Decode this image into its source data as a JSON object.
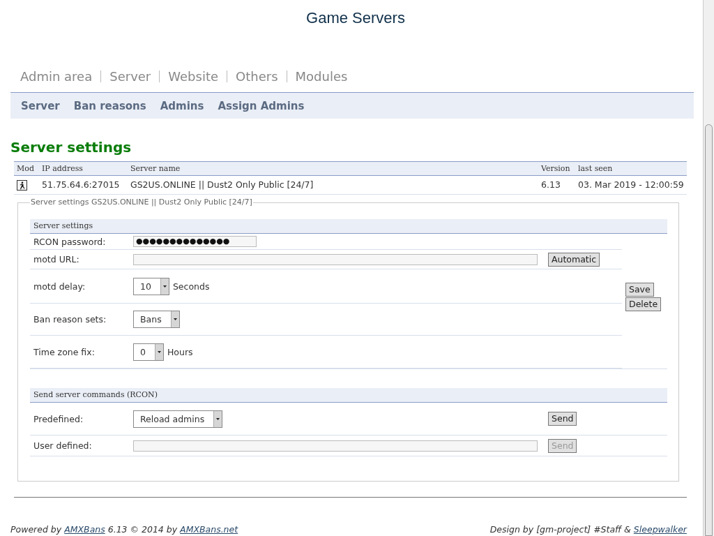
{
  "header": {
    "subtitle": "Game Servers"
  },
  "main_nav": [
    "Admin area",
    "Server",
    "Website",
    "Others",
    "Modules"
  ],
  "sub_nav": [
    "Server",
    "Ban reasons",
    "Admins",
    "Assign Admins"
  ],
  "page_title": "Server settings",
  "server_table": {
    "columns": [
      "Mod",
      "IP address",
      "Server name",
      "Version",
      "last seen"
    ],
    "rows": [
      {
        "ip_address": "51.75.64.6:27015",
        "server_name": "GS2US.ONLINE || Dust2 Only Public [24/7]",
        "version": "6.13",
        "last_seen": "03. Mar 2019 - 12:00:59"
      }
    ]
  },
  "server_form": {
    "legend": "Server settings GS2US.ONLINE || Dust2 Only Public [24/7]",
    "settings": {
      "title": "Server settings",
      "rows": [
        {
          "kind": "password",
          "label": "RCON password:",
          "value": "●●●●●●●●●●●●●●"
        },
        {
          "kind": "text",
          "label": "motd URL:",
          "button": {
            "label": "Automatic",
            "disabled": false
          }
        },
        {
          "kind": "select",
          "label": "motd delay:",
          "value": "10",
          "unit": "Seconds"
        },
        {
          "kind": "select",
          "label": "Ban reason sets:",
          "value": "Bans"
        },
        {
          "kind": "select",
          "label": "Time zone fix:",
          "value": "0",
          "unit": "Hours"
        }
      ],
      "side_buttons": [
        {
          "label": "Save",
          "disabled": false
        },
        {
          "label": "Delete",
          "disabled": false
        }
      ]
    },
    "rcon": {
      "title": "Send server commands (RCON)",
      "rows": [
        {
          "kind": "select",
          "label": "Predefined:",
          "value": "Reload admins",
          "button": {
            "label": "Send",
            "disabled": false
          }
        },
        {
          "kind": "text",
          "label": "User defined:",
          "button": {
            "label": "Send",
            "disabled": true
          }
        }
      ]
    }
  },
  "footer": {
    "left": [
      {
        "kind": "text",
        "text": "Powered by "
      },
      {
        "kind": "link",
        "text": "AMXBans"
      },
      {
        "kind": "text",
        "text": " 6.13 © 2014 by "
      },
      {
        "kind": "link",
        "text": "AMXBans.net"
      }
    ],
    "right": [
      {
        "kind": "text",
        "text": "Design by [gm-project] #Staff & "
      },
      {
        "kind": "link",
        "text": "Sleepwalker"
      }
    ]
  }
}
